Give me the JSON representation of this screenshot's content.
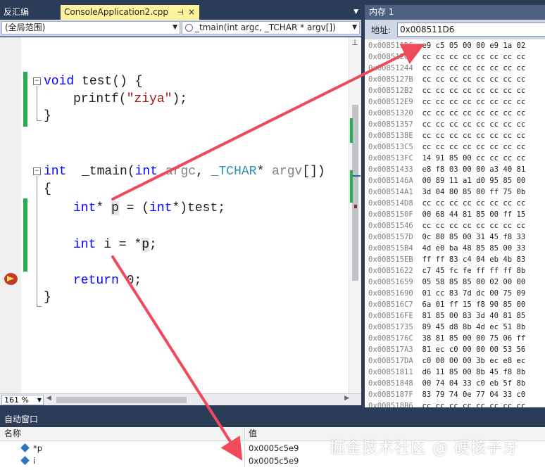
{
  "editor": {
    "tabs": {
      "inactive_label": "反汇编",
      "active_label": "ConsoleApplication2.cpp",
      "pin_glyph": "⊣",
      "close_glyph": "×",
      "dropdown_glyph": "▼"
    },
    "nav": {
      "scope": "(全局范围)",
      "function": "_tmain(int argc, _TCHAR * argv[])"
    },
    "code": {
      "line_void_test": "void test() {",
      "line_printf": "printf(\"ziya\");",
      "close_brace": "}",
      "open_brace": "{",
      "tmain_sig": "int _tmain(int argc, _TCHAR* argv[])",
      "line_ptr": "int* p = (int*)test;",
      "line_deref": "int i = *p;",
      "line_return": "return 0;"
    },
    "zoom": "161 %"
  },
  "memory": {
    "title": "内存 1",
    "address_label": "地址:",
    "address_value": "0x008511D6",
    "rows": [
      {
        "addr": "0x008511D6",
        "bytes": "e9 c5 05 00 00 e9 1a 02"
      },
      {
        "addr": "0x0085120D",
        "bytes": "cc cc cc cc cc cc cc cc"
      },
      {
        "addr": "0x00851244",
        "bytes": "cc cc cc cc cc cc cc cc"
      },
      {
        "addr": "0x0085127B",
        "bytes": "cc cc cc cc cc cc cc cc"
      },
      {
        "addr": "0x008512B2",
        "bytes": "cc cc cc cc cc cc cc cc"
      },
      {
        "addr": "0x008512E9",
        "bytes": "cc cc cc cc cc cc cc cc"
      },
      {
        "addr": "0x00851320",
        "bytes": "cc cc cc cc cc cc cc cc"
      },
      {
        "addr": "0x00851357",
        "bytes": "cc cc cc cc cc cc cc cc"
      },
      {
        "addr": "0x0085138E",
        "bytes": "cc cc cc cc cc cc cc cc"
      },
      {
        "addr": "0x008513C5",
        "bytes": "cc cc cc cc cc cc cc cc"
      },
      {
        "addr": "0x008513FC",
        "bytes": "14 91 85 00 cc cc cc cc"
      },
      {
        "addr": "0x00851433",
        "bytes": "e8 f8 03 00 00 a3 40 81"
      },
      {
        "addr": "0x0085146A",
        "bytes": "00 89 11 a1 d0 95 85 00"
      },
      {
        "addr": "0x008514A1",
        "bytes": "3d 04 80 85 00 ff 75 0b"
      },
      {
        "addr": "0x008514D8",
        "bytes": "cc cc cc cc cc cc cc cc"
      },
      {
        "addr": "0x0085150F",
        "bytes": "00 68 44 81 85 00 ff 15"
      },
      {
        "addr": "0x00851546",
        "bytes": "cc cc cc cc cc cc cc cc"
      },
      {
        "addr": "0x0085157D",
        "bytes": "0c 80 85 00 31 45 f8 33"
      },
      {
        "addr": "0x008515B4",
        "bytes": "4d e0 ba 48 85 85 00 33"
      },
      {
        "addr": "0x008515EB",
        "bytes": "ff ff 83 c4 04 eb 4b 83"
      },
      {
        "addr": "0x00851622",
        "bytes": "c7 45 fc fe ff ff ff 8b"
      },
      {
        "addr": "0x00851659",
        "bytes": "05 58 85 85 00 02 00 00"
      },
      {
        "addr": "0x00851690",
        "bytes": "01 cc 83 7d dc 00 75 09"
      },
      {
        "addr": "0x008516C7",
        "bytes": "6a 01 ff 15 f8 90 85 00"
      },
      {
        "addr": "0x008516FE",
        "bytes": "81 85 00 83 3d 40 81 85"
      },
      {
        "addr": "0x00851735",
        "bytes": "89 45 d8 8b 4d ec 51 8b"
      },
      {
        "addr": "0x0085176C",
        "bytes": "38 81 85 00 00 75 06 ff"
      },
      {
        "addr": "0x008517A3",
        "bytes": "81 ec c0 00 00 00 53 56"
      },
      {
        "addr": "0x008517DA",
        "bytes": "c0 00 00 00 3b ec e8 ec"
      },
      {
        "addr": "0x00851811",
        "bytes": "d6 11 85 00 8b 45 f8 8b"
      },
      {
        "addr": "0x00851848",
        "bytes": "00 74 04 33 c0 eb 5f 8b"
      },
      {
        "addr": "0x0085187F",
        "bytes": "83 79 74 0e 77 04 33 c0"
      },
      {
        "addr": "0x008518B6",
        "bytes": "cc cc cc cc cc cc cc cc"
      }
    ]
  },
  "autos": {
    "title": "自动窗口",
    "col_name": "名称",
    "col_value": "值",
    "rows": [
      {
        "name": "*p",
        "value": "0x0005c5e9"
      },
      {
        "name": "i",
        "value": "0x0005c5e9"
      }
    ]
  },
  "watermark": "掘金技术社区 @ 硬核子牙",
  "colors": {
    "arrow": "#f04a5a",
    "tab_active": "#fff29d",
    "change_bar": "#22b14c",
    "chrome_dark": "#2b3c59"
  }
}
